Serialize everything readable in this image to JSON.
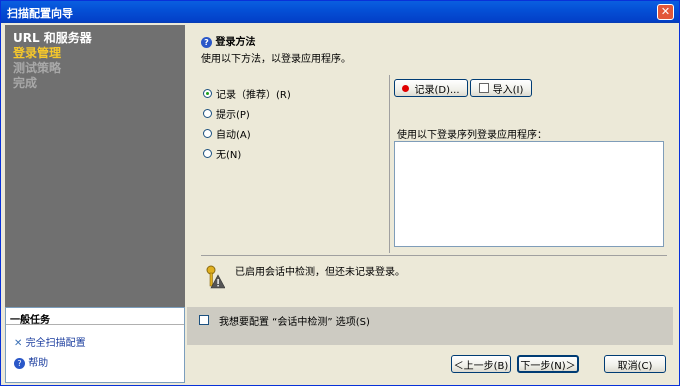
{
  "window": {
    "title": "扫描配置向导",
    "close_glyph": "✕"
  },
  "nav": {
    "items": [
      "URL 和服务器",
      "登录管理",
      "测试策略",
      "完成"
    ]
  },
  "tasks": {
    "header": "一般任务",
    "full_scan": "完全扫描配置",
    "help": "帮助"
  },
  "section": {
    "title": "登录方法",
    "description": "使用以下方法，以登录应用程序。"
  },
  "radios": [
    {
      "label": "记录（推荐）(R)",
      "selected": true
    },
    {
      "label": "提示(P)",
      "selected": false
    },
    {
      "label": "自动(A)",
      "selected": false
    },
    {
      "label": "无(N)",
      "selected": false
    }
  ],
  "buttons": {
    "record": "记录(D)...",
    "import": "导入(I)",
    "back": "＜上一步(B)",
    "next": "下一步(N)＞",
    "cancel": "取消(C)"
  },
  "sequence": {
    "label": "使用以下登录序列登录应用程序："
  },
  "note": "已启用会话中检测，但还未记录登录。",
  "checkbox": {
    "label": "我想要配置 “会话中检测” 选项(S)",
    "checked": false
  },
  "colors": {
    "titlebar": "#0450d6",
    "left_panel": "#707070",
    "active_nav": "#f7c82a",
    "record_dot": "#e00000"
  }
}
